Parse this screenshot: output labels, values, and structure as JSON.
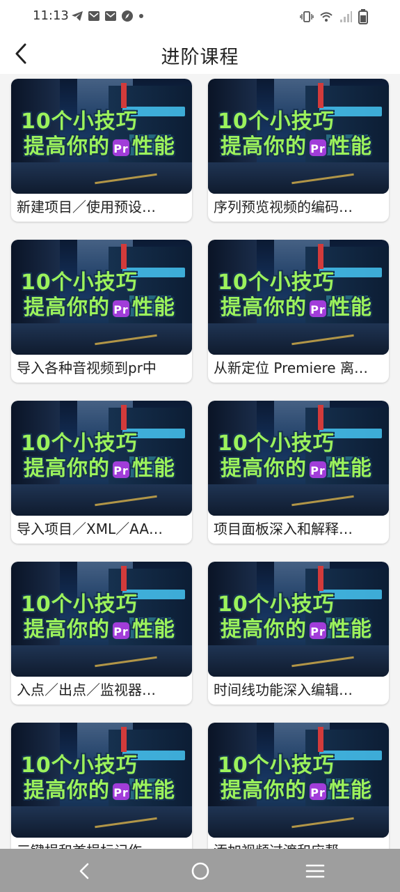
{
  "status_bar": {
    "time": "11:13"
  },
  "header": {
    "title": "进阶课程"
  },
  "thumbnail": {
    "line1": "10个小技巧",
    "line2_prefix": "提高你的",
    "badge": "Pr",
    "line2_suffix": "性能"
  },
  "courses": [
    {
      "title": "新建项目／使用预设…"
    },
    {
      "title": "序列预览视频的编码…"
    },
    {
      "title": "导入各种音视频到pr中"
    },
    {
      "title": "从新定位 Premiere 离…"
    },
    {
      "title": "导入项目／XML／AA…"
    },
    {
      "title": "项目面板深入和解释…"
    },
    {
      "title": "入点／出点／监视器…"
    },
    {
      "title": "时间线功能深入编辑…"
    },
    {
      "title": "三键捐和首捐标记作…"
    },
    {
      "title": "添加视频过渡和应帮…"
    }
  ],
  "colors": {
    "thumb_text": "#9cf25c",
    "badge": "#a13dd9",
    "nav_bar": "#9e9e9e"
  }
}
